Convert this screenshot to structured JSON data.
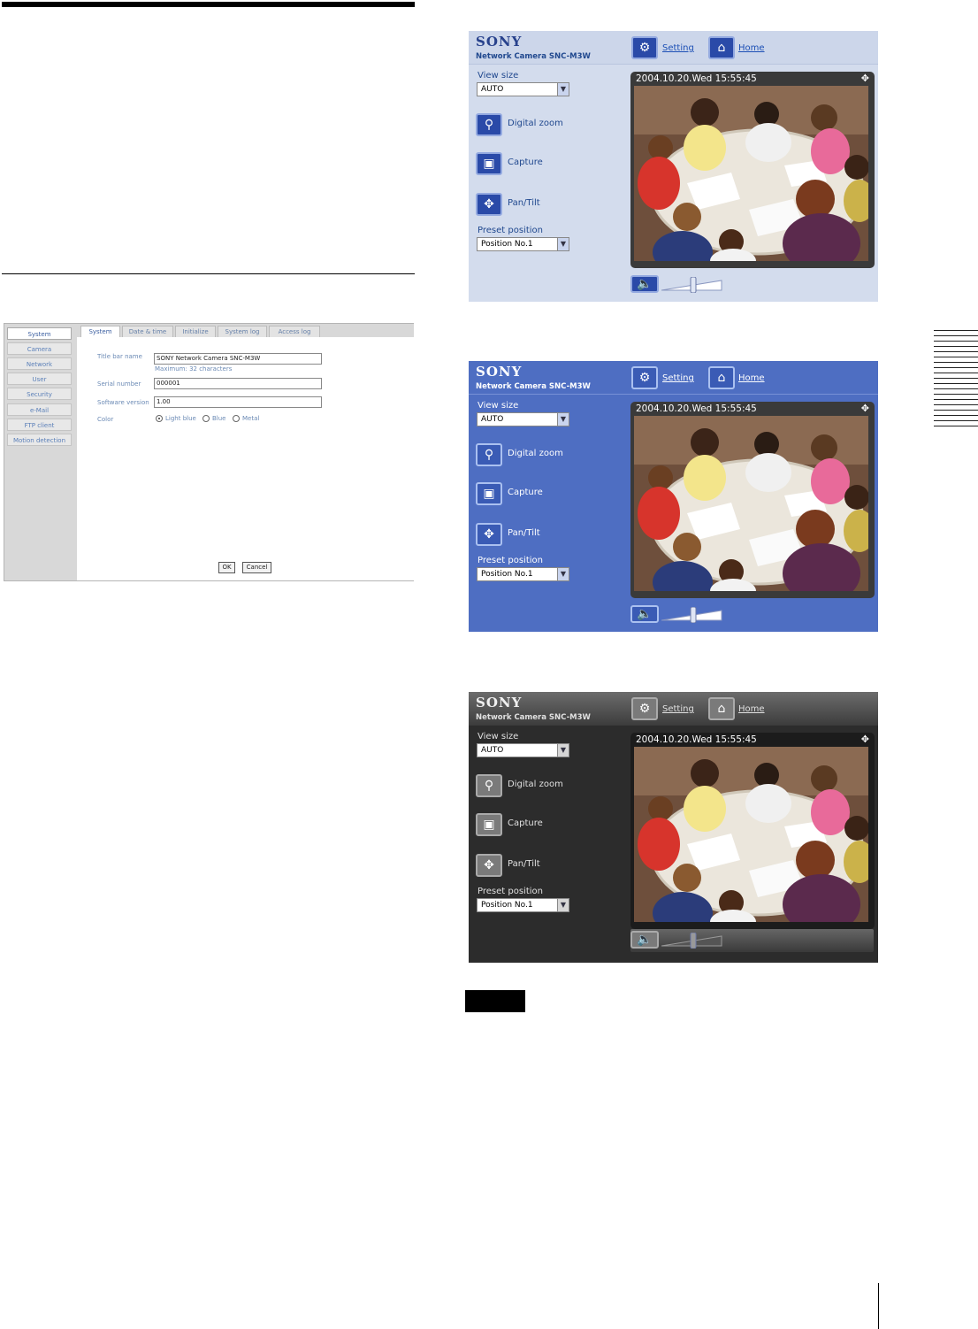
{
  "admin": {
    "sidebar": [
      "System",
      "Camera",
      "Network",
      "User",
      "Security",
      "e-Mail",
      "FTP client",
      "Motion detection"
    ],
    "tabs": [
      "System",
      "Date & time",
      "Initialize",
      "System log",
      "Access log"
    ],
    "fields": {
      "title_bar_label": "Title bar name",
      "title_bar_value": "SONY Network Camera SNC-M3W",
      "title_bar_hint": "Maximum: 32 characters",
      "serial_label": "Serial number",
      "serial_value": "000001",
      "software_label": "Software version",
      "software_value": "1.00",
      "color_label": "Color",
      "color_options": [
        "Light blue",
        "Blue",
        "Metal"
      ],
      "color_selected": "Light blue"
    },
    "ok": "OK",
    "cancel": "Cancel"
  },
  "viewer": {
    "brand": "SONY",
    "model": "Network Camera SNC-M3W",
    "setting": "Setting",
    "home": "Home",
    "view_size_label": "View size",
    "view_size_value": "AUTO",
    "digital_zoom": "Digital zoom",
    "capture": "Capture",
    "pan_tilt": "Pan/Tilt",
    "preset_label": "Preset position",
    "preset_value": "Position No.1",
    "timestamp": "2004.10.20.Wed 15:55:45",
    "themes": [
      "Light blue",
      "Blue",
      "Metal"
    ]
  }
}
